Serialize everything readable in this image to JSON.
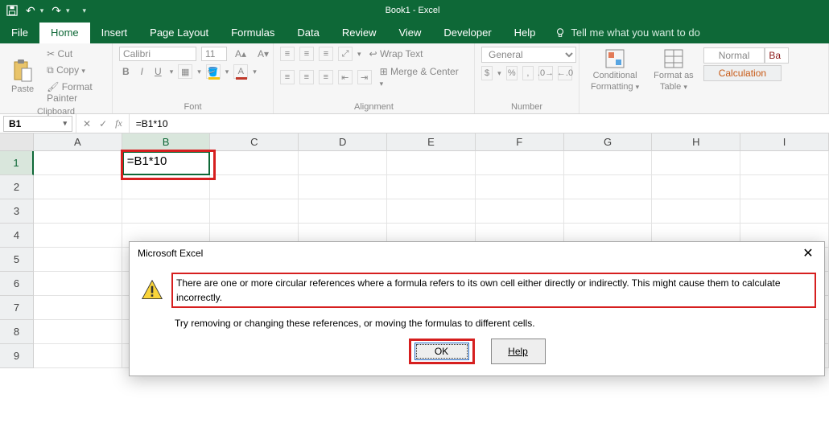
{
  "app": {
    "title": "Book1 - Excel"
  },
  "tabs": {
    "file": "File",
    "home": "Home",
    "insert": "Insert",
    "pageLayout": "Page Layout",
    "formulas": "Formulas",
    "data": "Data",
    "review": "Review",
    "view": "View",
    "developer": "Developer",
    "help": "Help",
    "tellme": "Tell me what you want to do"
  },
  "ribbon": {
    "clipboard": {
      "paste": "Paste",
      "cut": "Cut",
      "copy": "Copy",
      "fmtPainter": "Format Painter",
      "label": "Clipboard"
    },
    "font": {
      "name": "Calibri",
      "size": "11",
      "bold": "B",
      "italic": "I",
      "underline": "U",
      "label": "Font"
    },
    "alignment": {
      "wrap": "Wrap Text",
      "merge": "Merge & Center",
      "label": "Alignment"
    },
    "number": {
      "format": "General",
      "label": "Number"
    },
    "styles": {
      "cond": "Conditional",
      "cond2": "Formatting",
      "fmtTable": "Format as",
      "fmtTable2": "Table",
      "normal": "Normal",
      "bad": "Ba",
      "calc": "Calculation"
    },
    "moreDown": "▾"
  },
  "formulaBar": {
    "cellRef": "B1",
    "formula": "=B1*10"
  },
  "grid": {
    "columns": [
      "A",
      "B",
      "C",
      "D",
      "E",
      "F",
      "G",
      "H",
      "I"
    ],
    "rows": [
      "1",
      "2",
      "3",
      "4",
      "5",
      "6",
      "7",
      "8",
      "9"
    ],
    "b1Display": "=B1*10"
  },
  "dialog": {
    "title": "Microsoft Excel",
    "msg1": "There are one or more circular references where a formula refers to its own cell either directly or indirectly. This might cause them to calculate incorrectly.",
    "msg2": "Try removing or changing these references, or moving the formulas to different cells.",
    "ok": "OK",
    "help": "Help"
  }
}
